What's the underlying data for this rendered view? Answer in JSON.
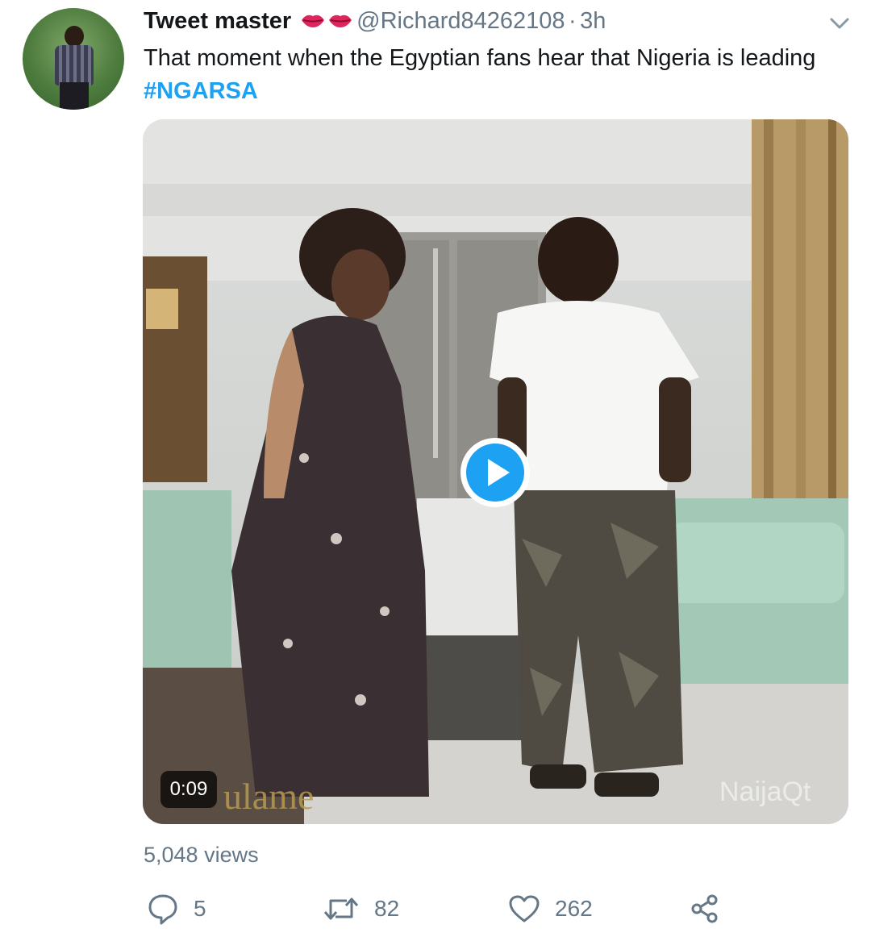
{
  "tweet": {
    "author_name": "Tweet master",
    "name_emoji": "👄👄",
    "handle": "@Richard84262108",
    "separator": "·",
    "time": "3h",
    "text_main": "That moment when the Egyptian fans hear that Nigeria is leading ",
    "hashtag": "#NGARSA"
  },
  "media": {
    "duration": "0:09",
    "watermark_left": "ulame",
    "watermark_right": "NaijaQt"
  },
  "stats": {
    "views": "5,048 views"
  },
  "actions": {
    "reply_count": "5",
    "retweet_count": "82",
    "like_count": "262"
  },
  "colors": {
    "accent": "#1da1f2",
    "muted": "#657786",
    "text": "#14171a"
  }
}
